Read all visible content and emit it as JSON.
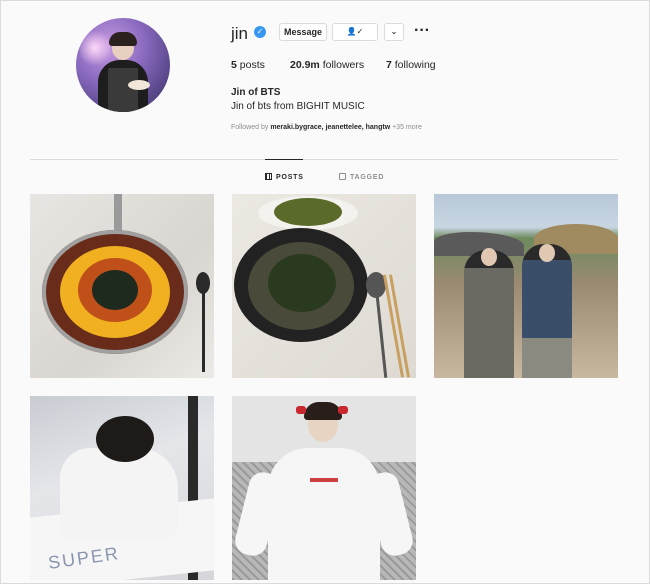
{
  "profile": {
    "username": "jin",
    "verified_glyph": "✓",
    "buttons": {
      "message": "Message",
      "follow_glyph": "👤✓",
      "suggest_glyph": "⌄",
      "more_glyph": "···"
    },
    "stats": {
      "posts_value": "5",
      "posts_label": "posts",
      "followers_value": "20.9m",
      "followers_label": "followers",
      "following_value": "7",
      "following_label": "following"
    },
    "full_name": "Jin of BTS",
    "bio": "Jin of bts from BIGHIT MUSIC",
    "followed_by_prefix": "Followed by",
    "followed_by_names": "meraki.bygrace,  jeanettelee, hangtw",
    "followed_by_more": "+35 more"
  },
  "tabs": {
    "posts": "POSTS",
    "tagged": "TAGGED"
  },
  "grid": {
    "items": [
      {
        "description": "food-pan-photo"
      },
      {
        "description": "bowl-photo"
      },
      {
        "description": "village-photo"
      },
      {
        "description": "drawing-photo"
      },
      {
        "description": "portrait-photo"
      }
    ],
    "drawing_text": "SUPER"
  },
  "colors": {
    "verified": "#3897f0",
    "background": "#fafafa",
    "border": "#dbdbdb",
    "muted": "#8e8e8e"
  }
}
